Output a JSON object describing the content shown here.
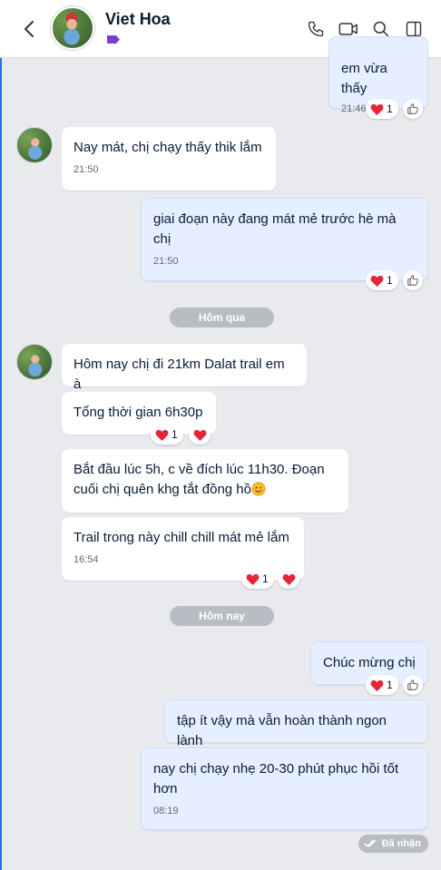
{
  "header": {
    "contact_name": "Viet Hoa",
    "icons": [
      "back-icon",
      "label-tag-icon",
      "phone-icon",
      "video-call-icon",
      "search-icon",
      "sidebar-toggle-icon"
    ]
  },
  "messages": [
    {
      "dir": "out",
      "text": "em vừa thấy",
      "time": "21:46",
      "reaction_count": "1"
    },
    {
      "dir": "in",
      "text": "Nay mát, chị chạy thấy thik lắm",
      "time": "21:50"
    },
    {
      "dir": "out",
      "text_lines": [
        "giai đoạn này đang mát mẻ trước hè mà",
        "chị"
      ],
      "time": "21:50",
      "reaction_count": "1"
    },
    {
      "dir": "in",
      "text": "Hôm nay chị đi 21km Dalat trail em à"
    },
    {
      "dir": "in",
      "text": "Tổng thời gian 6h30p",
      "reaction_count": "1"
    },
    {
      "dir": "in",
      "text_lines": [
        "Bắt đầu lúc 5h, c về đích lúc 11h30. Đoạn",
        "cuối chị quên khg tắt đồng hồ"
      ]
    },
    {
      "dir": "in",
      "text": "Trail trong này chill chill mát mẻ lắm",
      "time": "16:54",
      "reaction_count": "1"
    },
    {
      "dir": "out",
      "text": "Chúc mừng chị",
      "reaction_count": "1"
    },
    {
      "dir": "out",
      "text": "tập ít vậy mà vẫn hoàn thành ngon lành"
    },
    {
      "dir": "out",
      "text_lines": [
        "nay chị chạy nhẹ 20-30 phút phục hồi tốt",
        "hơn"
      ],
      "time": "08:19"
    }
  ],
  "dividers": {
    "yesterday": "Hôm qua",
    "today": "Hôm nay"
  },
  "status": {
    "seen": "Đã nhận"
  },
  "colors": {
    "accent": "#2d6fe8",
    "out_bubble": "#e5efff",
    "heart": "#e5253a"
  }
}
